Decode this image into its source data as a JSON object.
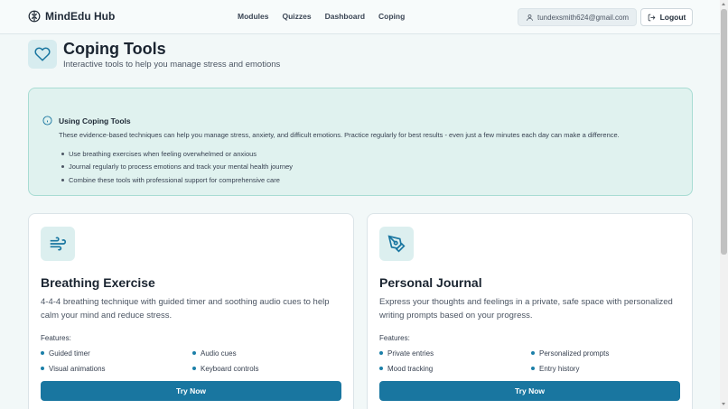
{
  "nav": {
    "brand": "MindEdu Hub",
    "links": [
      "Modules",
      "Quizzes",
      "Dashboard",
      "Coping"
    ],
    "user_email": "tundexsmith624@gmail.com",
    "logout_label": "Logout"
  },
  "header": {
    "title": "Coping Tools",
    "subtitle": "Interactive tools to help you manage stress and emotions"
  },
  "info": {
    "title": "Using Coping Tools",
    "text": "These evidence-based techniques can help you manage stress, anxiety, and difficult emotions. Practice regularly for best results - even just a few minutes each day can make a difference.",
    "tips": [
      "Use breathing exercises when feeling overwhelmed or anxious",
      "Journal regularly to process emotions and track your mental health journey",
      "Combine these tools with professional support for comprehensive care"
    ]
  },
  "cards": [
    {
      "icon": "wind-icon",
      "title": "Breathing Exercise",
      "description": "4-4-4 breathing technique with guided timer and soothing audio cues to help calm your mind and reduce stress.",
      "features_label": "Features:",
      "features": [
        "Guided timer",
        "Audio cues",
        "Visual animations",
        "Keyboard controls"
      ],
      "button": "Try Now"
    },
    {
      "icon": "pen-tool-icon",
      "title": "Personal Journal",
      "description": "Express your thoughts and feelings in a private, safe space with personalized writing prompts based on your progress.",
      "features_label": "Features:",
      "features": [
        "Private entries",
        "Personalized prompts",
        "Mood tracking",
        "Entry history"
      ],
      "button": "Try Now"
    }
  ],
  "colors": {
    "accent": "#1976a0",
    "info_bg": "#e0f2ef",
    "info_border": "#a8dcd3",
    "page_bg": "#f2f8f8"
  }
}
